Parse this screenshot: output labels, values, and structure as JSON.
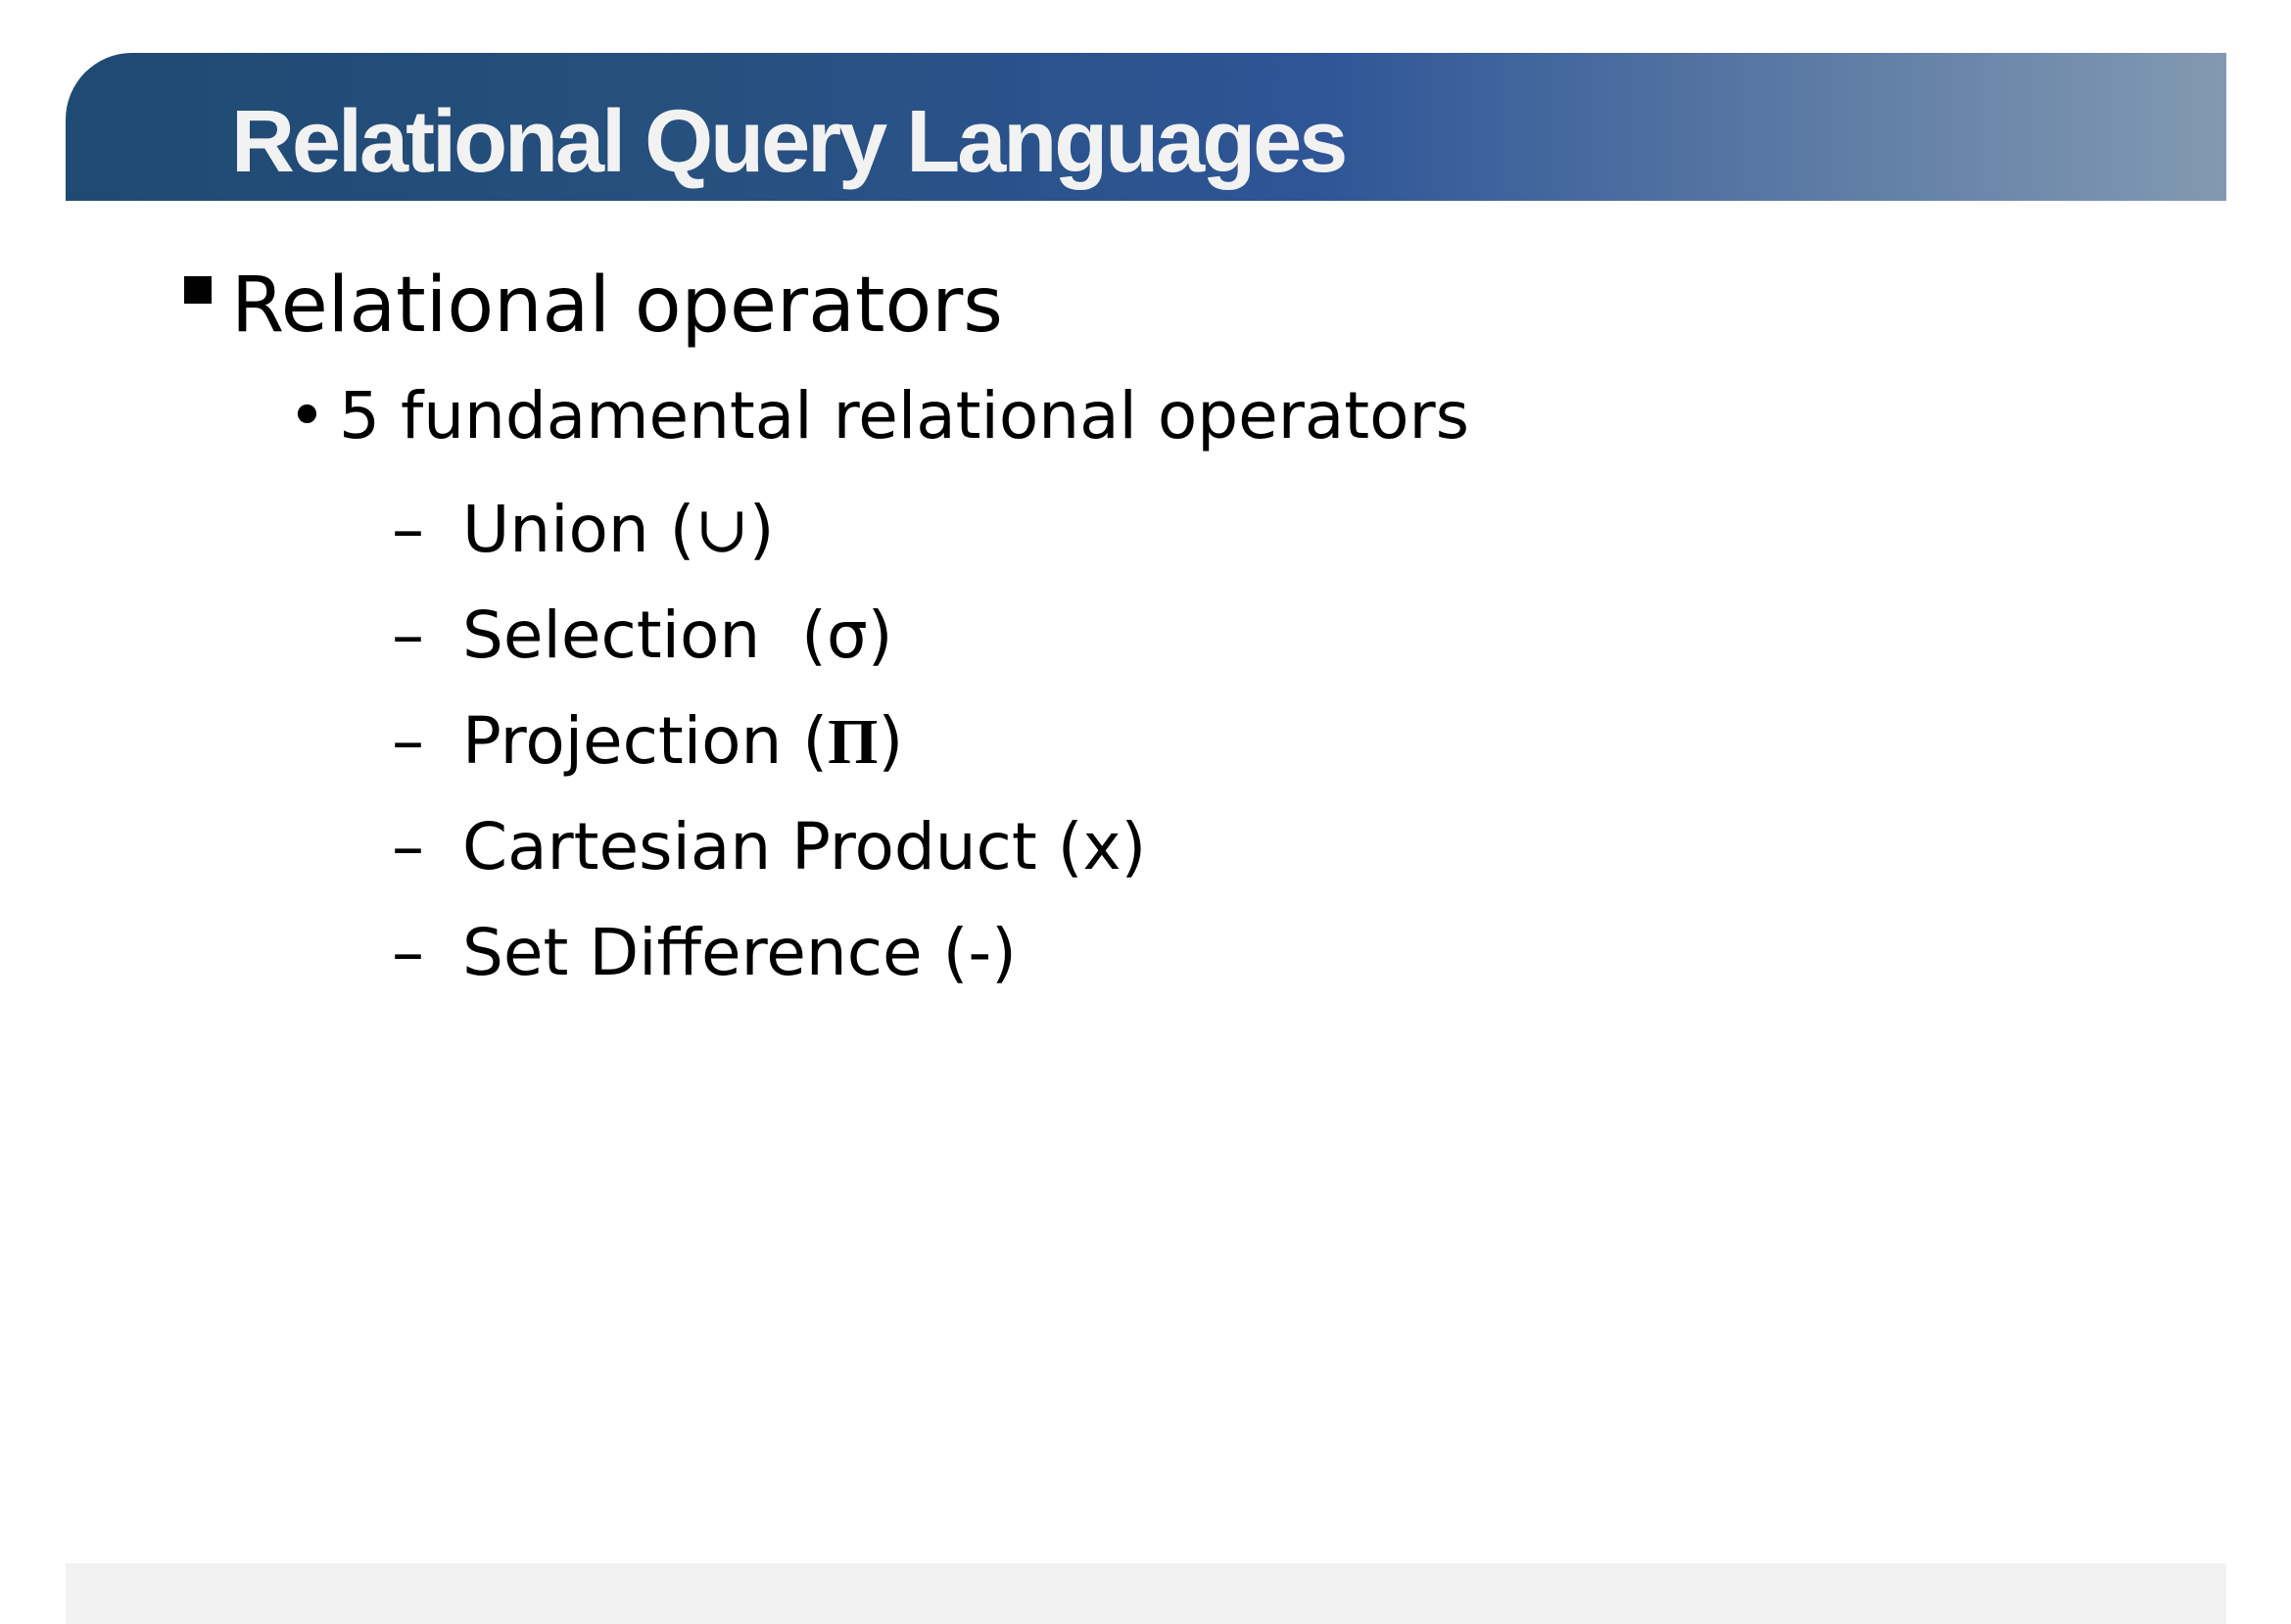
{
  "slide": {
    "title": "Relational Query Languages",
    "level1": {
      "bullet": "square-bullet",
      "text": "Relational operators"
    },
    "level2": {
      "bullet": "•",
      "text": "5 fundamental relational operators"
    },
    "operators": [
      {
        "dash": "–",
        "name": "Union (",
        "symbol": "∪",
        "close": ")"
      },
      {
        "dash": "–",
        "name": "Selection  (",
        "symbol": "σ",
        "close": ")"
      },
      {
        "dash": "–",
        "name": "Projection (",
        "symbol": "Π",
        "close": ")"
      },
      {
        "dash": "–",
        "name": "Cartesian Product (",
        "symbol": "x",
        "close": ")"
      },
      {
        "dash": "–",
        "name": "Set Difference (",
        "symbol": "-",
        "close": ")"
      }
    ]
  },
  "colors": {
    "title_bar_start": "#1f4a72",
    "title_bar_mid": "#2e5596",
    "title_bar_end": "#8399b2",
    "title_text": "#f2f2f2",
    "footer_bar": "#f2f2f2"
  }
}
